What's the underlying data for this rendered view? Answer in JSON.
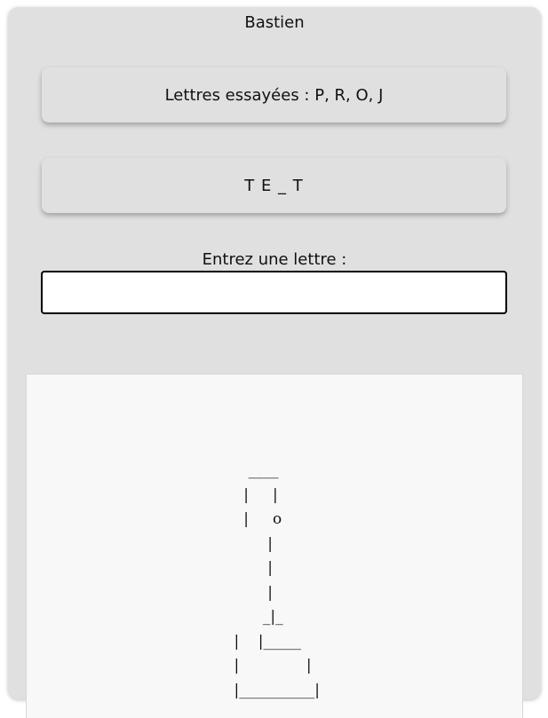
{
  "player": {
    "name": "Bastien"
  },
  "tried_letters": {
    "text": "Lettres essayées : P, R, O, J"
  },
  "word": {
    "display": "T E _ T"
  },
  "input": {
    "label": "Entrez une lettre :",
    "value": "",
    "placeholder": ""
  },
  "hangman": {
    "art": "    ____\n   |     |\n   |     o\n        |\n        |\n        |\n       _|_\n |    |_____\n |              |\n |__________|"
  }
}
